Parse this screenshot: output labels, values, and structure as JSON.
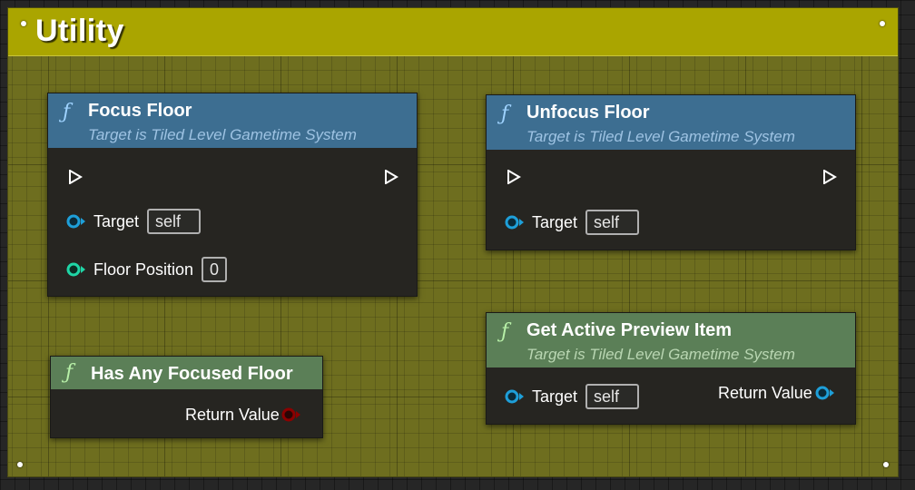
{
  "comment": {
    "title": "Utility",
    "color": "#aaa500"
  },
  "nodes": {
    "focus_floor": {
      "title": "Focus Floor",
      "subtitle": "Target is Tiled Level Gametime System",
      "target_label": "Target",
      "target_default": "self",
      "floor_position_label": "Floor Position",
      "floor_position_default": "0"
    },
    "unfocus_floor": {
      "title": "Unfocus Floor",
      "subtitle": "Target is Tiled Level Gametime System",
      "target_label": "Target",
      "target_default": "self"
    },
    "has_any_focused_floor": {
      "title": "Has Any Focused Floor",
      "return_label": "Return Value"
    },
    "get_active_preview_item": {
      "title": "Get Active Preview Item",
      "subtitle": "Target is Tiled Level Gametime System",
      "target_label": "Target",
      "target_default": "self",
      "return_label": "Return Value"
    }
  },
  "colors": {
    "function_header_blue": "#3d6e91",
    "pure_function_header_green": "#5b7f57",
    "object_pin": "#1e9fd9",
    "int_pin": "#1fd6a6",
    "bool_pin": "#8c0000",
    "exec_pin": "#ffffff"
  },
  "icons": {
    "function": "function-icon",
    "exec": "exec-pin-icon",
    "data_pin": "data-pin-icon"
  }
}
